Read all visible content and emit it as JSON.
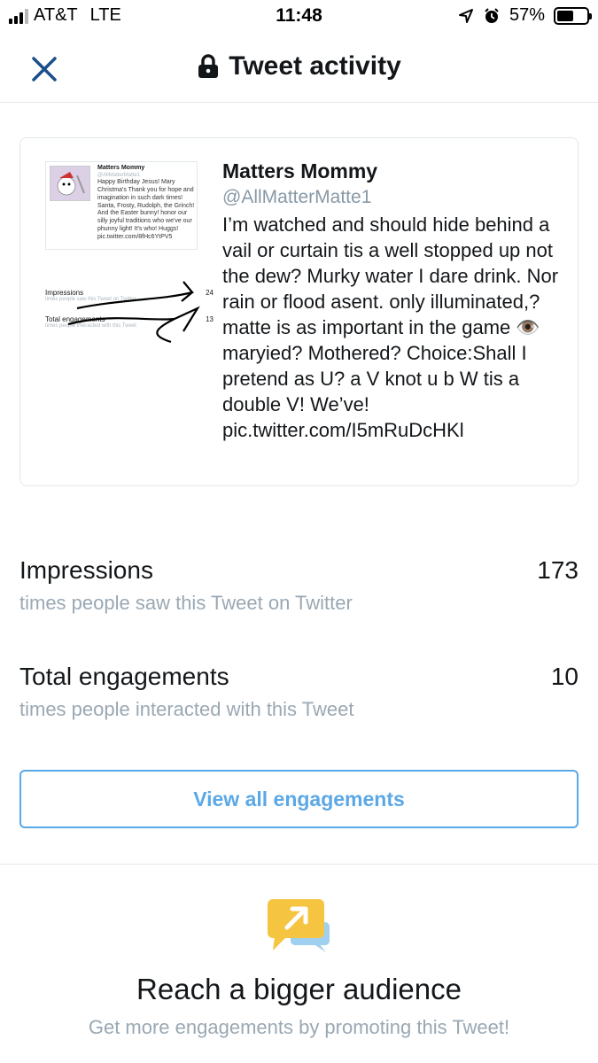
{
  "status_bar": {
    "carrier": "AT&T",
    "network": "LTE",
    "time": "11:48",
    "battery": "57%",
    "battery_level": 0.57
  },
  "header": {
    "title": "Tweet activity",
    "close_icon": "close-icon",
    "lock_icon": "lock-icon"
  },
  "tweet": {
    "name": "Matters Mommy",
    "handle": "@AllMatterMatte1",
    "text_before_emoji": "I’m watched and should hide behind a vail or curtain tis a well stopped up not the dew? Murky water I dare drink. Nor rain or flood asent. only illuminated,? matte is as important in the game ",
    "emoji": "👁️",
    "text_after_emoji": "maryied? Mothered? Choice:Shall I pretend as U? a V knot u b W tis a double V! We’ve! pic.twitter.com/I5mRuDcHKl",
    "thumbnail": {
      "name": "Matters Mommy",
      "handle": "@AllMatterMatte1",
      "text": "Happy Birthday Jesus! Mary Christma's Thank you for hope and imagination in such dark times! Santa, Frosty, Rudolph, the Grinch! And the Easter bunny! honor our silly joyful traditions who we've our phunny light! It's who! Huggs! pic.twitter.com/8fHc6YtPV5",
      "impressions_label": "Impressions",
      "impressions_sub": "times people saw this Tweet on Twitter",
      "impressions_value": "24",
      "engagements_label": "Total engagements",
      "engagements_sub": "times people interacted with this Tweet",
      "engagements_value": "13"
    }
  },
  "metrics": {
    "impressions": {
      "label": "Impressions",
      "sub": "times people saw this Tweet on Twitter",
      "value": "173"
    },
    "engagements": {
      "label": "Total engagements",
      "sub": "times people interacted with this Tweet",
      "value": "10"
    }
  },
  "view_all_button": "View all engagements",
  "promo": {
    "icon": "promote-icon",
    "title": "Reach a bigger audience",
    "subtitle": "Get more engagements by promoting this Tweet!"
  },
  "colors": {
    "accent": "#5ba8e6",
    "secondary_text": "#9aa8b3",
    "promo_yellow": "#f5c542",
    "promo_blue": "#9fd0f0"
  }
}
